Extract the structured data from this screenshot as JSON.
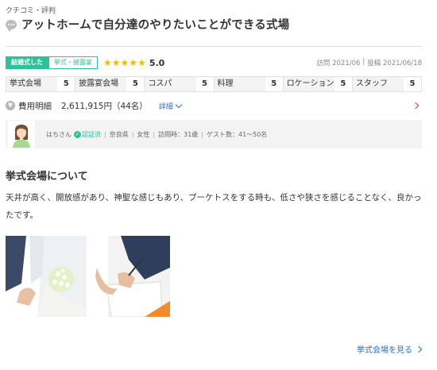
{
  "header": {
    "section_label": "クチコミ・評判",
    "title": "アットホームで自分達のやりたいことができる式場"
  },
  "meta": {
    "badge_main": "結婚式した",
    "badge_sub": "挙式・披露宴",
    "rating_stars": 5,
    "rating": "5.0",
    "visit_date": "訪問 2021/06",
    "separator": "|",
    "post_date": "投稿 2021/06/18",
    "star_color": "#f5b800",
    "accent_color": "#2bc29a"
  },
  "scores": [
    {
      "label": "挙式会場",
      "value": "5"
    },
    {
      "label": "披露宴会場",
      "value": "5"
    },
    {
      "label": "コスパ",
      "value": "5"
    },
    {
      "label": "料理",
      "value": "5"
    },
    {
      "label": "ロケーション",
      "value": "5"
    },
    {
      "label": "スタッフ",
      "value": "5"
    }
  ],
  "cost": {
    "icon": "yen-icon",
    "label": "費用明細",
    "value": "2,611,915円（44名）",
    "detail_link": "詳細"
  },
  "user": {
    "name": "はちさん",
    "verified_label": "認証済",
    "prefecture": "奈良県",
    "gender": "女性",
    "age": "訪問時：31歳",
    "guests": "ゲスト数：41～50名"
  },
  "review": {
    "section_title": "挙式会場について",
    "text": "天井が高く、開放感があり、神聖な感じもあり、ブーケトスをする時も、低さや狭さを感じることなく、良かったです。"
  },
  "footer": {
    "venue_link": "挙式会場を見る"
  },
  "link_color": "#2a6fbd"
}
